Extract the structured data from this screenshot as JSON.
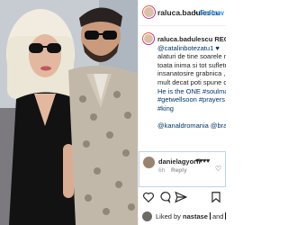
{
  "post": {
    "photo_alt": "photo-post"
  },
  "header": {
    "username": "raluca.badulescu",
    "separator": "•",
    "follow_label": "Follow"
  },
  "caption": {
    "lines": [
      "raluca.badulescu REGELE",
      "@catalinbotezatu1 ♥",
      "alaturi de tine soarele nos",
      "toata inima si tot sufletul",
      "insanatosire grabnica , te",
      "mult decat poti spune cuv",
      "He is the ONE #soulmate",
      "#getwellsoon #prayers",
      "#king",
      "",
      "@kanaldromania @bravo"
    ]
  },
  "comment": {
    "username": "danielagyorfi",
    "text": "♥♥♥♥",
    "time": "6h",
    "reply_label": "Reply"
  },
  "actions": {
    "like": "heart-outline-icon",
    "comment": "speech-bubble-icon",
    "share": "paper-plane-icon",
    "save": "bookmark-icon"
  },
  "likes": {
    "prefix": "Liked by",
    "user": "nastase",
    "and_label": "and"
  },
  "colors": {
    "link": "#3897f0",
    "caption_link": "#003569",
    "text": "#262626",
    "muted": "#999999"
  }
}
